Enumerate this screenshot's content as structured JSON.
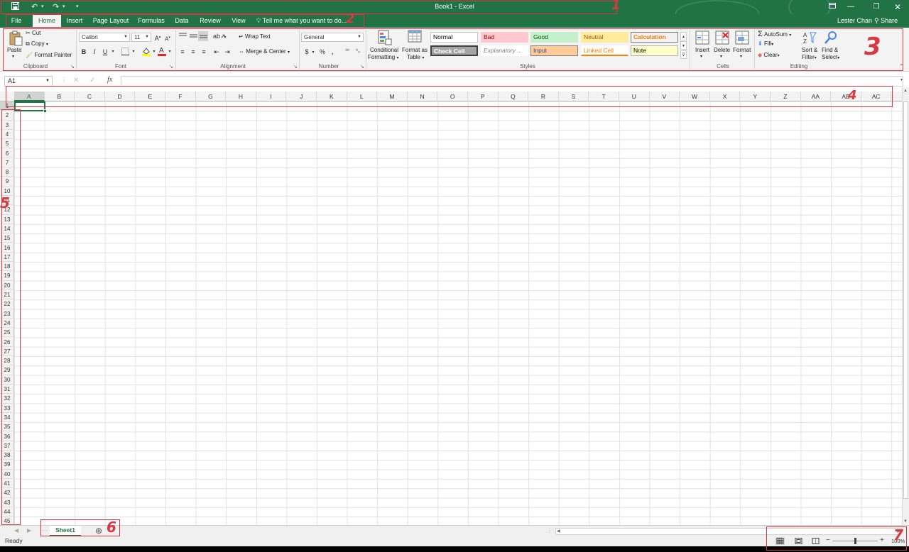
{
  "titlebar": {
    "title": "Book1 - Excel",
    "qat_save_icon": "save-icon",
    "qat_undo_icon": "undo-icon",
    "qat_redo_icon": "redo-icon",
    "qat_customize_icon": "customize-arrow-icon"
  },
  "tabs": [
    "File",
    "Home",
    "Insert",
    "Page Layout",
    "Formulas",
    "Data",
    "Review",
    "View"
  ],
  "tell_me": "Tell me what you want to do...",
  "user_name": "Lester Chan",
  "share_label": "Share",
  "ribbon": {
    "clipboard": {
      "paste": "Paste",
      "cut": "Cut",
      "copy": "Copy",
      "format_painter": "Format Painter",
      "label": "Clipboard"
    },
    "font": {
      "family": "Calibri",
      "size": "11",
      "bold": "B",
      "italic": "I",
      "underline": "U",
      "label": "Font"
    },
    "alignment": {
      "wrap_text": "Wrap Text",
      "merge_center": "Merge & Center",
      "label": "Alignment"
    },
    "number": {
      "format": "General",
      "currency": "$",
      "percent": "%",
      "comma": ",",
      "label": "Number"
    },
    "styles": {
      "conditional_formatting_1": "Conditional",
      "conditional_formatting_2": "Formatting",
      "format_as_table_1": "Format as",
      "format_as_table_2": "Table",
      "cells": [
        "Normal",
        "Bad",
        "Good",
        "Neutral",
        "Calculation",
        "Check Cell",
        "Explanatory ...",
        "Input",
        "Linked Cell",
        "Note"
      ],
      "label": "Styles"
    },
    "cells": {
      "insert": "Insert",
      "delete": "Delete",
      "format": "Format",
      "label": "Cells"
    },
    "editing": {
      "autosum": "AutoSum",
      "fill": "Fill",
      "clear": "Clear",
      "sort_filter_1": "Sort &",
      "sort_filter_2": "Filter",
      "find_select_1": "Find &",
      "find_select_2": "Select",
      "label": "Editing"
    }
  },
  "formula_bar": {
    "name_box": "A1",
    "fx": "fx",
    "content": ""
  },
  "columns": [
    "A",
    "B",
    "C",
    "D",
    "E",
    "F",
    "G",
    "H",
    "I",
    "J",
    "K",
    "L",
    "M",
    "N",
    "O",
    "P",
    "Q",
    "R",
    "S",
    "T",
    "U",
    "V",
    "W",
    "X",
    "Y",
    "Z",
    "AA",
    "AB",
    "AC"
  ],
  "rows": [
    "1",
    "2",
    "3",
    "4",
    "5",
    "6",
    "7",
    "8",
    "9",
    "10",
    "11",
    "12",
    "13",
    "14",
    "15",
    "16",
    "17",
    "18",
    "19",
    "20",
    "21",
    "22",
    "23",
    "24",
    "25",
    "26",
    "27",
    "28",
    "29",
    "30",
    "31",
    "32",
    "33",
    "34",
    "35",
    "36",
    "37",
    "38",
    "39",
    "40",
    "41",
    "42",
    "43",
    "44",
    "45"
  ],
  "selected_cell": "A1",
  "sheets": [
    "Sheet1"
  ],
  "add_sheet_icon": "plus-circle-icon",
  "status": {
    "ready": "Ready",
    "zoom": "100%"
  },
  "annotations": [
    "1",
    "2",
    "3",
    "4",
    "5",
    "6",
    "7"
  ],
  "colors": {
    "excel_green": "#217346",
    "annotation_red": "#d8383f",
    "style_bad_bg": "#ffc7ce",
    "style_good_bg": "#c6efce",
    "style_neutral_bg": "#ffeb9c",
    "style_input_bg": "#ffcc99",
    "style_note_bg": "#ffffcc",
    "style_check_bg": "#a5a5a5"
  }
}
